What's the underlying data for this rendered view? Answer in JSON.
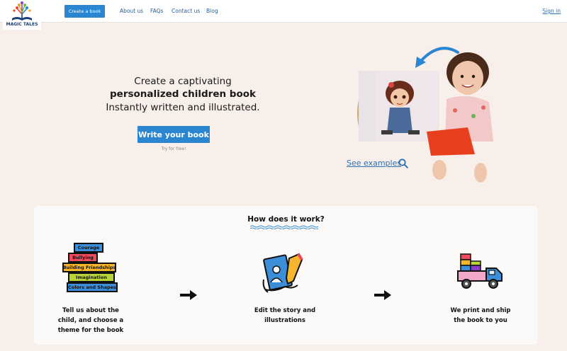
{
  "header": {
    "logo_text": "MAGIC TALES",
    "create_button": "Create a book",
    "nav": [
      "About us",
      "FAQs",
      "Contact us",
      "Blog"
    ],
    "signin": "Sign in"
  },
  "hero": {
    "line1": "Create a captivating",
    "line2": "personalized children book",
    "line3": "Instantly written and illustrated.",
    "cta": "Write your book",
    "cta_note": "Try for free!",
    "see_examples": "See examples"
  },
  "how": {
    "title": "How does it work?",
    "theme_books": [
      "Courage",
      "Bullying",
      "Building Friendships",
      "Imagination",
      "Colors and Shapes"
    ],
    "steps": [
      {
        "lines": [
          "Tell us about the",
          "child, and choose a",
          "theme for the book"
        ]
      },
      {
        "lines": [
          "Edit the story and",
          "illustrations"
        ]
      },
      {
        "lines": [
          "We print and ship",
          "the book to you"
        ]
      }
    ]
  },
  "colors": {
    "accent": "#2a86d1",
    "background": "#f8efea",
    "link": "#2a6fb3"
  },
  "icons": [
    "book-tree-logo-icon",
    "search-icon",
    "arrow-right-icon",
    "pencil-drawing-icon",
    "delivery-truck-icon"
  ]
}
